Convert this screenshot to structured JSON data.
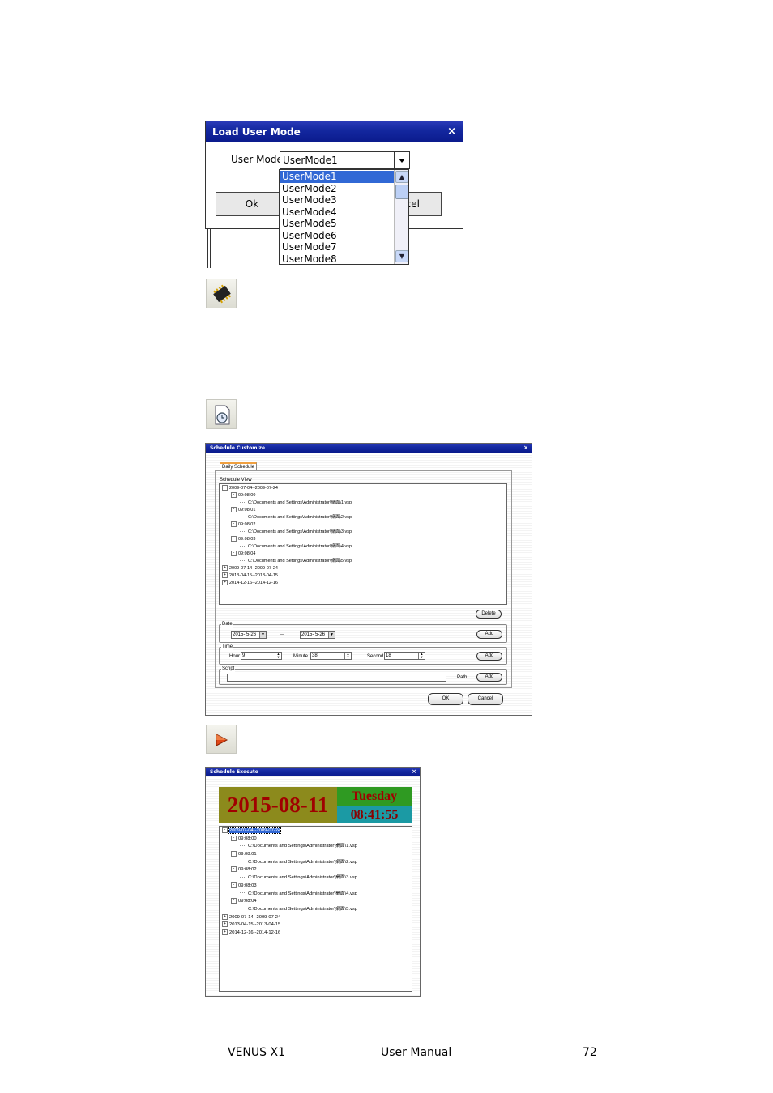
{
  "load_user_mode": {
    "title": "Load User Mode",
    "close": "×",
    "field_label": "User Mode",
    "selected": "UserMode1",
    "options": [
      "UserMode1",
      "UserMode2",
      "UserMode3",
      "UserMode4",
      "UserMode5",
      "UserMode6",
      "UserMode7",
      "UserMode8"
    ],
    "ok_label": "Ok",
    "cancel_fragment": "cel"
  },
  "schedule_customize": {
    "title": "Schedule Customize",
    "close": "×",
    "tab": "Daily Schedule",
    "view_label": "Schedule View",
    "tree": [
      {
        "text": "2009-07-04--2009-07-24",
        "level": 0,
        "sign": "−"
      },
      {
        "text": "09:08:00",
        "level": 1,
        "sign": "−"
      },
      {
        "text": "C:\\Documents and Settings\\Administrator\\桌面\\1.vsp",
        "level": 2,
        "sign": ""
      },
      {
        "text": "09:08:01",
        "level": 1,
        "sign": "−"
      },
      {
        "text": "C:\\Documents and Settings\\Administrator\\桌面\\2.vsp",
        "level": 2,
        "sign": ""
      },
      {
        "text": "09:08:02",
        "level": 1,
        "sign": "−"
      },
      {
        "text": "C:\\Documents and Settings\\Administrator\\桌面\\3.vsp",
        "level": 2,
        "sign": ""
      },
      {
        "text": "09:08:03",
        "level": 1,
        "sign": "−"
      },
      {
        "text": "C:\\Documents and Settings\\Administrator\\桌面\\4.vsp",
        "level": 2,
        "sign": ""
      },
      {
        "text": "09:08:04",
        "level": 1,
        "sign": "−"
      },
      {
        "text": "C:\\Documents and Settings\\Administrator\\桌面\\5.vsp",
        "level": 2,
        "sign": ""
      },
      {
        "text": "2009-07-14--2009-07-24",
        "level": 0,
        "sign": "+"
      },
      {
        "text": "2013-04-15--2013-04-15",
        "level": 0,
        "sign": "+"
      },
      {
        "text": "2014-12-16--2014-12-16",
        "level": 0,
        "sign": "+"
      }
    ],
    "delete_label": "Delete",
    "date_label": "Date",
    "date_from": "2015- 5-26",
    "date_sep": "--",
    "date_to": "2015- 5-26",
    "add_label": "Add",
    "time_label": "Time",
    "hour_label": "Hour",
    "hour_value": "9",
    "minute_label": "Minute",
    "minute_value": "38",
    "second_label": "Second",
    "second_value": "18",
    "script_label": "Script",
    "path_label": "Path",
    "ok_label": "OK",
    "cancel_label": "Cancel"
  },
  "schedule_execute": {
    "title": "Schedule Execute",
    "close": "×",
    "date": "2015-08-11",
    "weekday": "Tuesday",
    "time": "08:41:55",
    "tree": [
      {
        "text": "2009-07-04--2009-07-24",
        "level": 0,
        "sign": "−",
        "selected": true
      },
      {
        "text": "09:08:00",
        "level": 1,
        "sign": "−"
      },
      {
        "text": "C:\\Documents and Settings\\Administrator\\桌面\\1.vsp",
        "level": 2,
        "sign": ""
      },
      {
        "text": "09:08:01",
        "level": 1,
        "sign": "−"
      },
      {
        "text": "C:\\Documents and Settings\\Administrator\\桌面\\2.vsp",
        "level": 2,
        "sign": ""
      },
      {
        "text": "09:08:02",
        "level": 1,
        "sign": "−"
      },
      {
        "text": "C:\\Documents and Settings\\Administrator\\桌面\\3.vsp",
        "level": 2,
        "sign": ""
      },
      {
        "text": "09:08:03",
        "level": 1,
        "sign": "−"
      },
      {
        "text": "C:\\Documents and Settings\\Administrator\\桌面\\4.vsp",
        "level": 2,
        "sign": ""
      },
      {
        "text": "09:08:04",
        "level": 1,
        "sign": "−"
      },
      {
        "text": "C:\\Documents and Settings\\Administrator\\桌面\\5.vsp",
        "level": 2,
        "sign": ""
      },
      {
        "text": "2009-07-14--2009-07-24",
        "level": 0,
        "sign": "+"
      },
      {
        "text": "2013-04-15--2013-04-15",
        "level": 0,
        "sign": "+"
      },
      {
        "text": "2014-12-16--2014-12-16",
        "level": 0,
        "sign": "+"
      }
    ]
  },
  "icons": {
    "chip": "chip-icon",
    "schedule": "schedule-clock-icon",
    "play": "play-icon"
  },
  "footer": {
    "product": "VENUS X1",
    "doc": "User Manual",
    "page": "72"
  }
}
